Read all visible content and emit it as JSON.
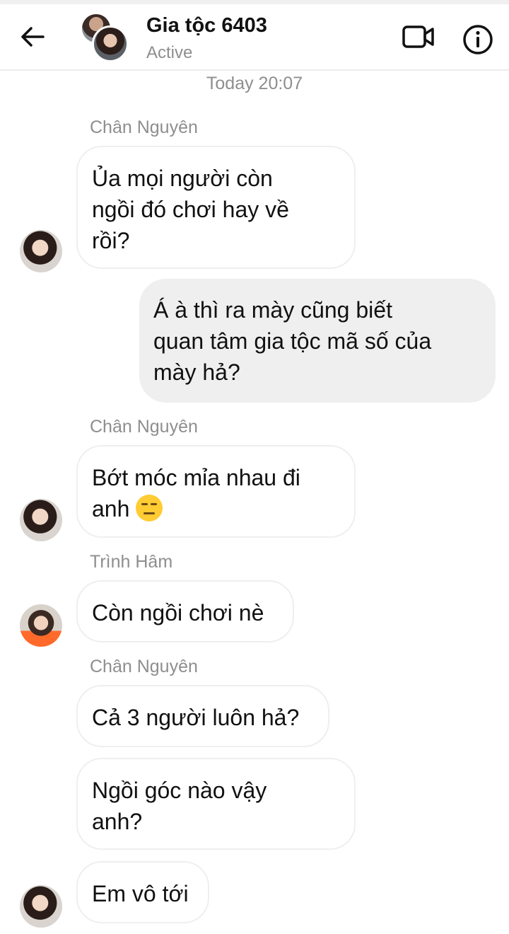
{
  "header": {
    "title": "Gia tộc 6403",
    "status": "Active",
    "back_icon": "arrow-left-icon",
    "video_icon": "video-camera-icon",
    "info_icon": "info-icon"
  },
  "timestamp": "Today 20:07",
  "messages": [
    {
      "sender": "Chân Nguyên",
      "text_lines": [
        "Ủa mọi người còn",
        "ngồi đó chơi hay về",
        "rồi?"
      ]
    },
    {
      "sender": "me",
      "text_lines": [
        "Á à thì ra mày cũng biết",
        "quan tâm gia tộc mã số của",
        "mày hả?"
      ]
    },
    {
      "sender": "Chân Nguyên",
      "text_lines": [
        "Bớt móc mỉa nhau đi",
        "anh"
      ],
      "emoji": "expressionless-face"
    },
    {
      "sender": "Trình Hâm",
      "text_lines": [
        "Còn ngồi chơi nè"
      ]
    },
    {
      "sender": "Chân Nguyên",
      "text_lines": [
        "Cả 3 người luôn hả?"
      ]
    },
    {
      "sender": "Chân Nguyên",
      "text_lines": [
        "Ngồi góc nào vậy",
        "anh?"
      ]
    },
    {
      "sender": "Chân Nguyên",
      "text_lines": [
        "Em vô tới"
      ]
    }
  ],
  "colors": {
    "incoming_bubble": "#ffffff",
    "outgoing_bubble": "#efefef",
    "muted_text": "#8e8e8e"
  }
}
